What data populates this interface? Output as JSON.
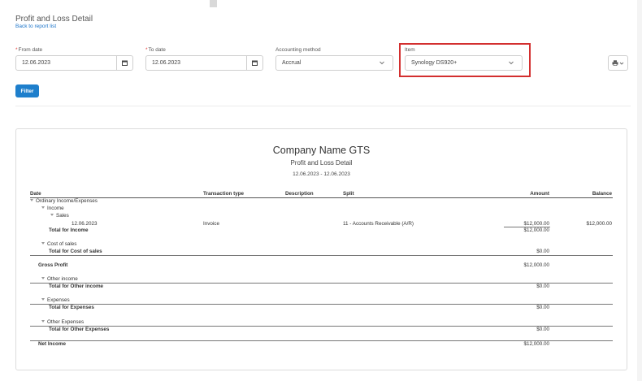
{
  "header": {
    "title": "Profit and Loss Detail",
    "back_link": "Back to report list"
  },
  "filters": {
    "from_date": {
      "label": "From date",
      "required": true,
      "value": "12.06.2023"
    },
    "to_date": {
      "label": "To date",
      "required": true,
      "value": "12.06.2023"
    },
    "accounting_method": {
      "label": "Accounting method",
      "value": "Accrual"
    },
    "item": {
      "label": "Item",
      "value": "Synology DS920+"
    },
    "required_mark": "*",
    "filter_button": "Filter"
  },
  "report": {
    "company": "Company Name GTS",
    "name": "Profit and Loss Detail",
    "date_range": "12.06.2023 - 12.06.2023",
    "columns": [
      "Date",
      "Transaction type",
      "Description",
      "Split",
      "Amount",
      "Balance"
    ],
    "rows": {
      "ordinary": "Ordinary Income/Expenses",
      "income": "Income",
      "sales": "Sales",
      "txn_date": "12.06.2023",
      "txn_type": "Invoice",
      "txn_split": "11 - Accounts Receivable (A/R)",
      "txn_amount": "$12,000.00",
      "txn_balance": "$12,000.00",
      "total_income": "Total for Income",
      "total_income_amt": "$12,000.00",
      "cost_of_sales": "Cost of sales",
      "total_cos": "Total for Cost of sales",
      "total_cos_amt": "$0.00",
      "gross_profit": "Gross Profit",
      "gross_profit_amt": "$12,000.00",
      "other_income": "Other income",
      "total_other_income": "Total for Other income",
      "total_other_income_amt": "$0.00",
      "expenses": "Expenses",
      "total_expenses": "Total for Expenses",
      "total_expenses_amt": "$0.00",
      "other_expenses": "Other Expenses",
      "total_other_expenses": "Total for Other Expenses",
      "total_other_expenses_amt": "$0.00",
      "net_income": "Net Income",
      "net_income_amt": "$12,000.00"
    }
  },
  "icons": {
    "calendar": "calendar-icon",
    "chevron": "chevron-down-icon",
    "print": "printer-icon",
    "expand": "triangle-down-icon"
  },
  "colors": {
    "accent": "#1e7fcc",
    "highlight": "#d32f2f",
    "required": "#e53935"
  }
}
